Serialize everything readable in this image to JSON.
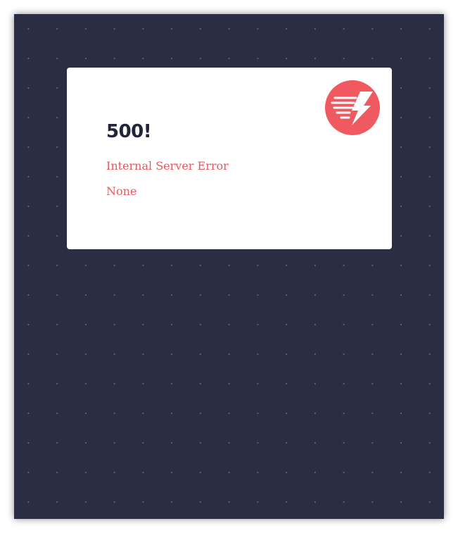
{
  "page": {
    "background_color": "#2b2d42",
    "card_color": "#ffffff",
    "accent_color": "#f0595f"
  },
  "error": {
    "code_title": "500!",
    "status_text": "Internal Server Error",
    "detail_text": "None"
  },
  "logo": {
    "icon": "lightning-bolt-speed-icon"
  }
}
